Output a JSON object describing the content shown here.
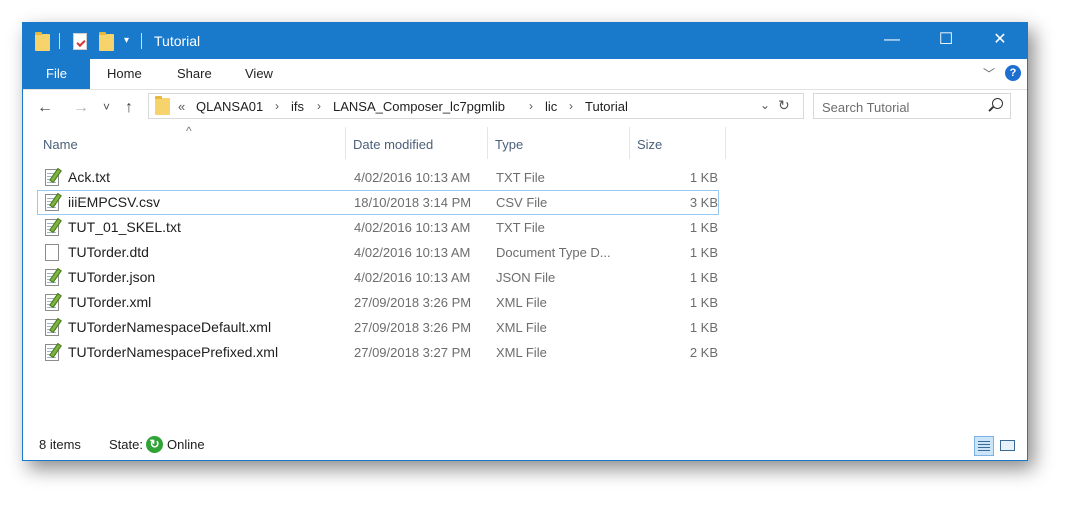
{
  "window": {
    "title": "Tutorial",
    "accent_color": "#1979ca",
    "quick_access_dropdown": "▾",
    "buttons": {
      "minimize": "—",
      "maximize": "☐",
      "close": "✕"
    }
  },
  "ribbon": {
    "tabs": [
      "File",
      "Home",
      "Share",
      "View"
    ],
    "expand_icon": "﹀",
    "help_label": "?"
  },
  "nav": {
    "back": "←",
    "forward": "→",
    "recent": "˅",
    "up": "↑",
    "overflow": "«",
    "breadcrumb": [
      "QLANSA01",
      "ifs",
      "LANSA_Composer_lc7pgmlib",
      "lic",
      "Tutorial"
    ],
    "separator": "›",
    "dropdown": "⌄",
    "refresh": "↻",
    "search_placeholder": "Search Tutorial"
  },
  "columns": {
    "name": "Name",
    "date": "Date modified",
    "type": "Type",
    "size": "Size",
    "sort_indicator": "^"
  },
  "files": [
    {
      "name": "Ack.txt",
      "date": "4/02/2016 10:13 AM",
      "type": "TXT File",
      "size": "1 KB",
      "icon": "notepad-file-icon",
      "selected": false
    },
    {
      "name": "iiiEMPCSV.csv",
      "date": "18/10/2018 3:14 PM",
      "type": "CSV File",
      "size": "3 KB",
      "icon": "notepad-file-icon",
      "selected": true
    },
    {
      "name": "TUT_01_SKEL.txt",
      "date": "4/02/2016 10:13 AM",
      "type": "TXT File",
      "size": "1 KB",
      "icon": "notepad-file-icon",
      "selected": false
    },
    {
      "name": "TUTorder.dtd",
      "date": "4/02/2016 10:13 AM",
      "type": "Document Type D...",
      "size": "1 KB",
      "icon": "blank-file-icon",
      "selected": false
    },
    {
      "name": "TUTorder.json",
      "date": "4/02/2016 10:13 AM",
      "type": "JSON File",
      "size": "1 KB",
      "icon": "notepad-file-icon",
      "selected": false
    },
    {
      "name": "TUTorder.xml",
      "date": "27/09/2018 3:26 PM",
      "type": "XML File",
      "size": "1 KB",
      "icon": "notepad-file-icon",
      "selected": false
    },
    {
      "name": "TUTorderNamespaceDefault.xml",
      "date": "27/09/2018 3:26 PM",
      "type": "XML File",
      "size": "1 KB",
      "icon": "notepad-file-icon",
      "selected": false
    },
    {
      "name": "TUTorderNamespacePrefixed.xml",
      "date": "27/09/2018 3:27 PM",
      "type": "XML File",
      "size": "2 KB",
      "icon": "notepad-file-icon",
      "selected": false
    }
  ],
  "status": {
    "item_count": "8 items",
    "state_label": "State:",
    "state_value": "Online",
    "online_glyph": "↻"
  }
}
